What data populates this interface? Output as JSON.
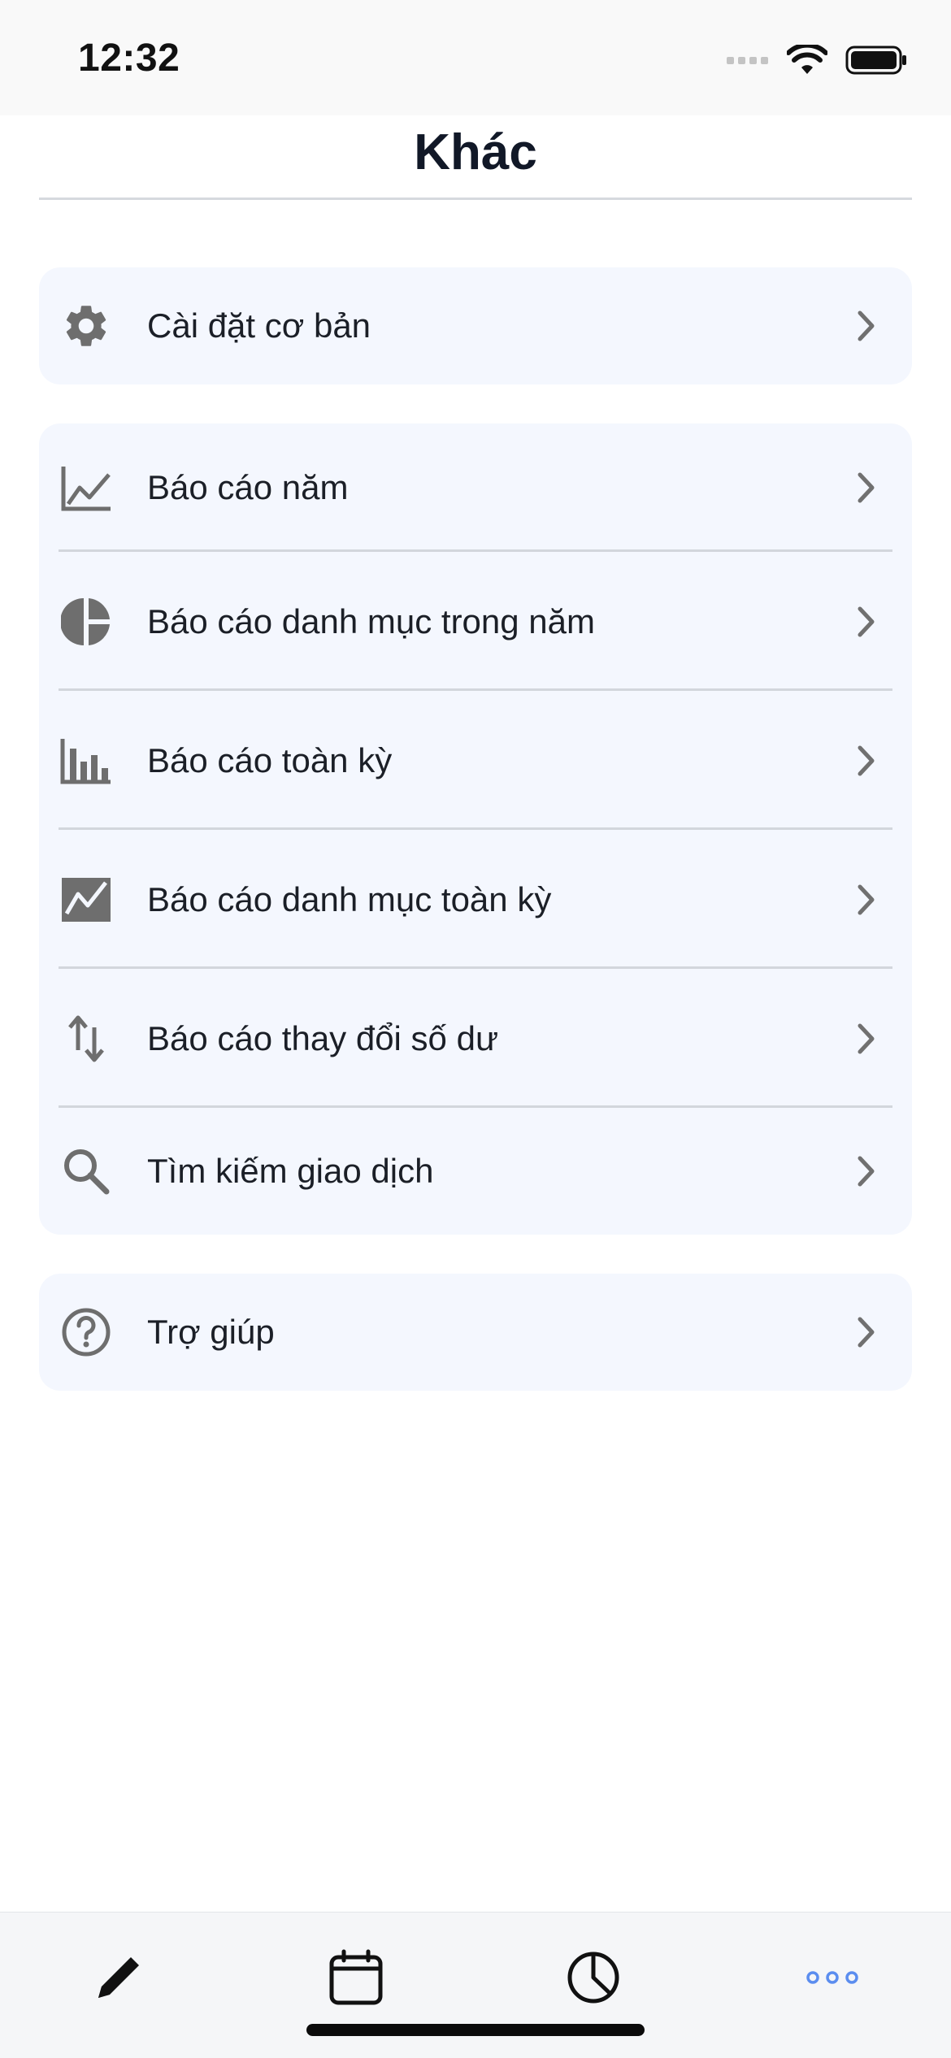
{
  "status_bar": {
    "time": "12:32"
  },
  "header": {
    "title": "Khác"
  },
  "groups": [
    {
      "items": [
        {
          "label": "Cài đặt cơ bản",
          "icon": "gear-icon"
        }
      ]
    },
    {
      "items": [
        {
          "label": "Báo cáo năm",
          "icon": "line-chart-icon"
        },
        {
          "label": "Báo cáo danh mục trong năm",
          "icon": "pie-chart-icon"
        },
        {
          "label": "Báo cáo toàn kỳ",
          "icon": "bar-chart-icon"
        },
        {
          "label": "Báo cáo danh mục toàn kỳ",
          "icon": "area-chart-icon"
        },
        {
          "label": "Báo cáo thay đổi số dư",
          "icon": "swap-vertical-icon"
        },
        {
          "label": "Tìm kiếm giao dịch",
          "icon": "search-icon"
        }
      ]
    },
    {
      "items": [
        {
          "label": "Trợ giúp",
          "icon": "help-circle-icon"
        }
      ]
    }
  ],
  "tab_bar": {
    "tabs": [
      {
        "icon": "pencil-icon",
        "active": false
      },
      {
        "icon": "calendar-icon",
        "active": false
      },
      {
        "icon": "pie-chart-outline-icon",
        "active": false
      },
      {
        "icon": "more-dots-icon",
        "active": true
      }
    ]
  },
  "colors": {
    "group_background": "#f4f7fe",
    "icon_gray": "#6e6e6e",
    "active_tab": "#5b8def",
    "title_text": "#111827"
  }
}
